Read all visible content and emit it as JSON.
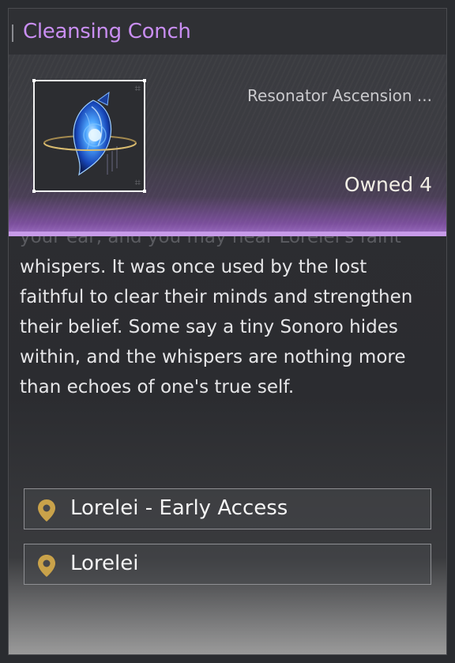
{
  "item": {
    "name": "Cleansing Conch",
    "category": "Resonator Ascension ...",
    "owned_label": "Owned 4",
    "icon": "blue-conch-shell-icon"
  },
  "description": {
    "cut_line": "your ear, and you may hear Lorelei's faint",
    "text": "whispers. It was once used by the lost faithful to clear their minds and strengthen their belief. Some say a tiny Sonoro hides within, and the whispers are nothing more than echoes of one's true self."
  },
  "sources": [
    {
      "label": "Lorelei - Early Access",
      "icon": "location-pin-icon"
    },
    {
      "label": "Lorelei",
      "icon": "location-pin-icon"
    }
  ],
  "colors": {
    "title": "#c98ef2",
    "accent_strip": "#c79ae8",
    "pin": "#c9a24a"
  }
}
